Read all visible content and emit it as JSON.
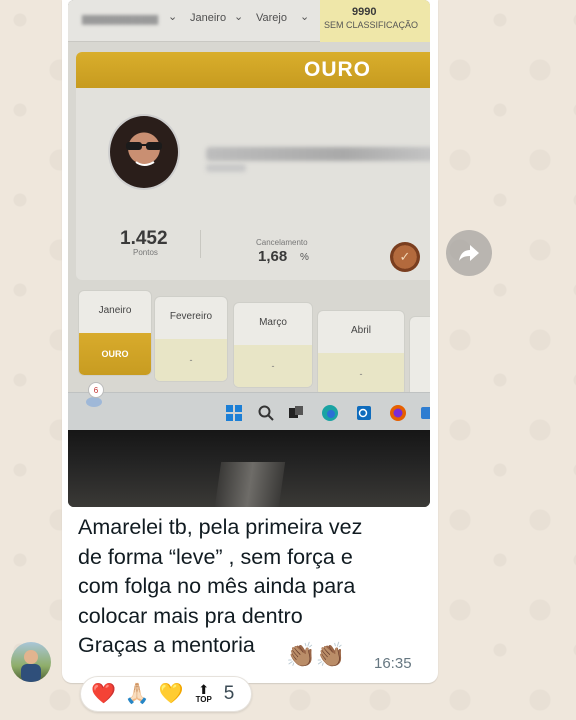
{
  "photo": {
    "filters": [
      "Janeiro",
      "Varejo"
    ],
    "score_value": "9990",
    "score_label": "SEM CLASSIFICAÇÃO",
    "card_title": "OURO",
    "points_value": "1.452",
    "points_label": "Pontos",
    "cancel_label": "Cancelamento",
    "cancel_value": "1,68",
    "cancel_unit": "%",
    "months": [
      {
        "name": "Janeiro",
        "status": "OURO"
      },
      {
        "name": "Fevereiro",
        "status": "-"
      },
      {
        "name": "Março",
        "status": "-"
      },
      {
        "name": "Abril",
        "status": "-"
      }
    ],
    "notification_count": "6"
  },
  "message": {
    "text": "Amarelei tb, pela primeira vez\nde forma “leve” , sem força e\ncom folga no mês ainda para\ncolocar mais pra dentro\nGraças a mentoria",
    "emoji": "👏🏽👏🏽",
    "time": "16:35"
  },
  "reactions": {
    "emojis": [
      "❤️",
      "🙏🏻",
      "💛"
    ],
    "top_label": "TOP",
    "count": "5"
  },
  "colors": {
    "gold": "#d4a82a",
    "chat_bg": "#efe7dc",
    "bubble": "#ffffff"
  }
}
